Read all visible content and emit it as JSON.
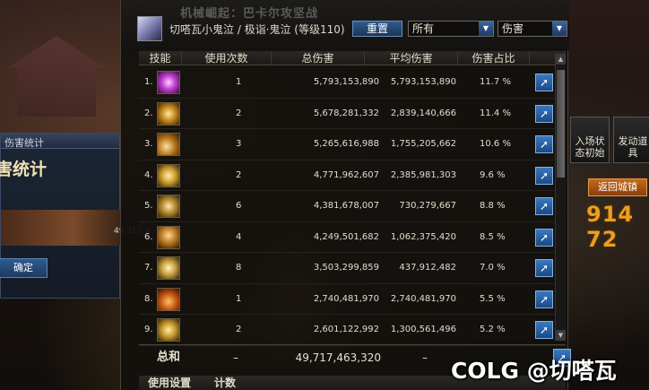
{
  "background": {
    "left_window_title": "伤害统计",
    "left_window_heading": "害统计",
    "left_window_value": "49,717,4",
    "left_confirm": "确定",
    "right_return_button": "返回城镇",
    "right_button_1": "入场状态初始",
    "right_button_2": "发动道具",
    "right_digits": "914 72"
  },
  "window": {
    "title": "机械崛起：巴卡尔攻坚战",
    "character": "切嗒瓦小鬼泣 / 极诣·鬼泣 (等级110)",
    "reset_button": "重置",
    "filter_select": "所有",
    "type_select": "伤害"
  },
  "table": {
    "headers": {
      "skill": "技能",
      "count": "使用次数",
      "total": "总伤害",
      "avg": "平均伤害",
      "pct": "伤害占比"
    },
    "rows": [
      {
        "idx": "1.",
        "count": "1",
        "total": "5,793,153,890",
        "avg": "5,793,153,890",
        "pct": "11.7 %"
      },
      {
        "idx": "2.",
        "count": "2",
        "total": "5,678,281,332",
        "avg": "2,839,140,666",
        "pct": "11.4 %"
      },
      {
        "idx": "3.",
        "count": "3",
        "total": "5,265,616,988",
        "avg": "1,755,205,662",
        "pct": "10.6 %"
      },
      {
        "idx": "4.",
        "count": "2",
        "total": "4,771,962,607",
        "avg": "2,385,981,303",
        "pct": "9.6 %"
      },
      {
        "idx": "5.",
        "count": "6",
        "total": "4,381,678,007",
        "avg": "730,279,667",
        "pct": "8.8 %"
      },
      {
        "idx": "6.",
        "count": "4",
        "total": "4,249,501,682",
        "avg": "1,062,375,420",
        "pct": "8.5 %"
      },
      {
        "idx": "7.",
        "count": "8",
        "total": "3,503,299,859",
        "avg": "437,912,482",
        "pct": "7.0 %"
      },
      {
        "idx": "8.",
        "count": "1",
        "total": "2,740,481,970",
        "avg": "2,740,481,970",
        "pct": "5.5 %"
      },
      {
        "idx": "9.",
        "count": "2",
        "total": "2,601,122,992",
        "avg": "1,300,561,496",
        "pct": "5.2 %"
      }
    ],
    "total_label": "总和",
    "total_count": "–",
    "total_damage": "49,717,463,320",
    "total_avg": "–"
  },
  "footer": {
    "setting": "使用设置",
    "count": "计数"
  },
  "watermark": "COLG @切嗒瓦"
}
